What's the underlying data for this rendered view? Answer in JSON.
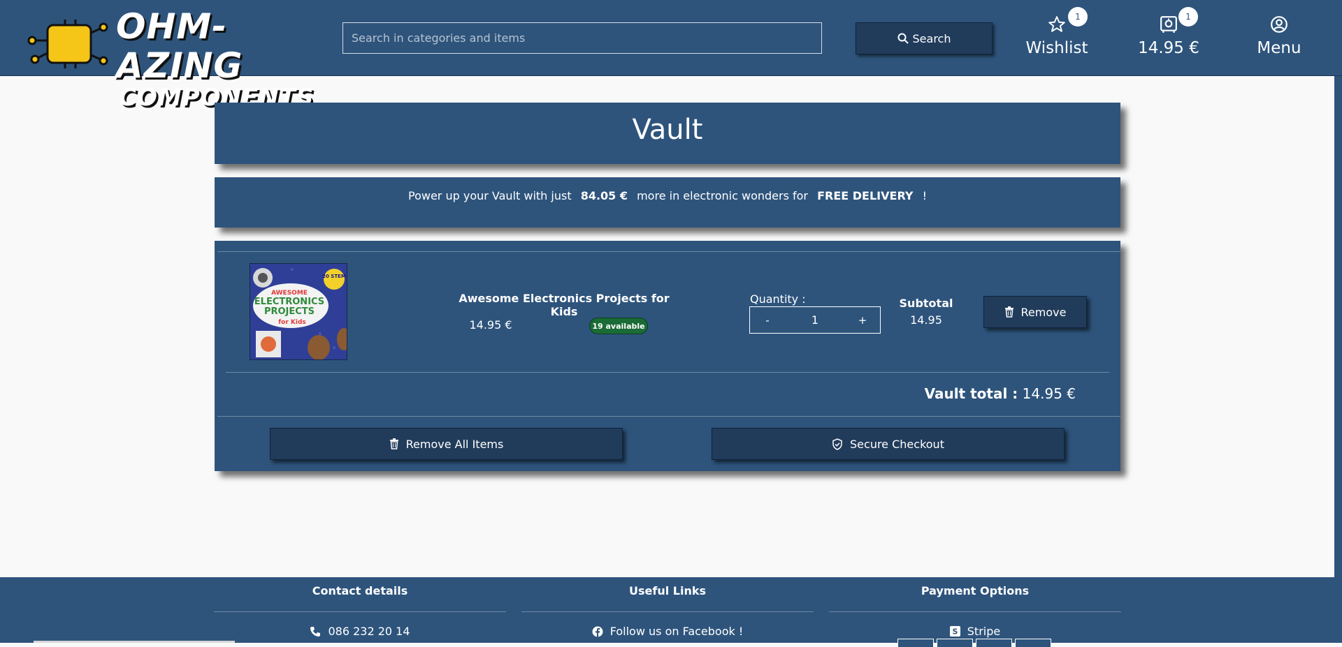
{
  "brand": {
    "line1": "OHM-AZING",
    "line2": "COMPONENTS"
  },
  "search": {
    "placeholder": "Search in categories and items",
    "button_label": "Search"
  },
  "header": {
    "wishlist": {
      "label": "Wishlist",
      "count": "1"
    },
    "cart": {
      "label": "14.95 €",
      "count": "1"
    },
    "menu": {
      "label": "Menu"
    }
  },
  "vault": {
    "title": "Vault",
    "promo": {
      "before": "Power up your Vault with just",
      "amount": "84.05 €",
      "middle": "more in electronic wonders for",
      "highlight": "FREE DELIVERY",
      "end": "!"
    },
    "items": [
      {
        "name": "Awesome Electronics Projects for Kids",
        "price": "14.95 €",
        "availability": "19 available",
        "quantity_label": "Quantity :",
        "quantity": "1",
        "decrement": "-",
        "increment": "+",
        "subtotal_label": "Subtotal",
        "subtotal": "14.95",
        "remove_label": "Remove",
        "image": {
          "top_badge": "20 STEM",
          "line1": "AWESOME",
          "line2": "ELECTRONICS",
          "line3": "PROJECTS",
          "line4": "for Kids"
        }
      }
    ],
    "total_label": "Vault total :",
    "total_value": "14.95 €",
    "remove_all_label": "Remove All Items",
    "checkout_label": "Secure Checkout"
  },
  "footer": {
    "contact": {
      "heading": "Contact details",
      "phone": "086 232 20 14"
    },
    "links": {
      "heading": "Useful Links",
      "facebook": "Follow us on Facebook !"
    },
    "payment": {
      "heading": "Payment Options",
      "stripe": "Stripe"
    }
  },
  "colors": {
    "primary": "#2e547c",
    "button": "#213c5b",
    "success": "#1a6b35",
    "background": "#f9f9f9",
    "logo_yellow": "#f5c518"
  }
}
